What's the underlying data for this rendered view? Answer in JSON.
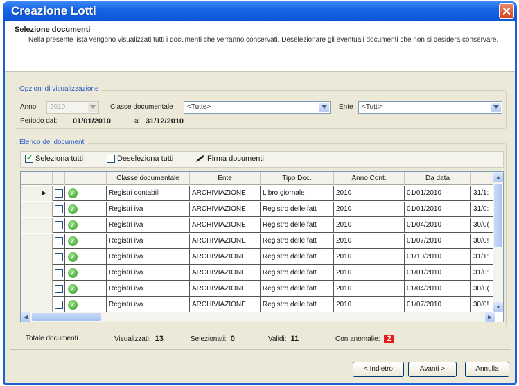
{
  "window": {
    "title": "Creazione Lotti"
  },
  "header": {
    "title": "Selezione documenti",
    "description": "Nella presente lista vengono visualizzati tutti i documenti che verranno conservati. Deselezionare gli eventuali documenti che non si desidera conservare."
  },
  "options": {
    "group_title": "Opzioni di visualizzazione",
    "anno_label": "Anno",
    "anno_value": "2010",
    "classe_label": "Classe documentale",
    "classe_value": "<Tutte>",
    "ente_label": "Ente",
    "ente_value": "<Tutti>",
    "periodo_label": "Periodo dal:",
    "periodo_from": "01/01/2010",
    "al_label": "al",
    "periodo_to": "31/12/2010"
  },
  "docs": {
    "group_title": "Elenco dei documenti",
    "toolbar": {
      "select_all": "Seleziona tutti",
      "deselect_all": "Deseleziona tutti",
      "sign": "Firma documenti"
    },
    "columns": [
      "Classe documentale",
      "Ente",
      "Tipo Doc.",
      "Anno Cont.",
      "Da data",
      ""
    ],
    "rows": [
      [
        "Registri contabili",
        "ARCHIVIAZIONE",
        "Libro giornale",
        "2010",
        "01/01/2010",
        "31/1:"
      ],
      [
        "Registri iva",
        "ARCHIVIAZIONE",
        "Registro delle fatt",
        "2010",
        "01/01/2010",
        "31/0:"
      ],
      [
        "Registri iva",
        "ARCHIVIAZIONE",
        "Registro delle fatt",
        "2010",
        "01/04/2010",
        "30/0("
      ],
      [
        "Registri iva",
        "ARCHIVIAZIONE",
        "Registro delle fatt",
        "2010",
        "01/07/2010",
        "30/0!"
      ],
      [
        "Registri iva",
        "ARCHIVIAZIONE",
        "Registro delle fatt",
        "2010",
        "01/10/2010",
        "31/1:"
      ],
      [
        "Registri iva",
        "ARCHIVIAZIONE",
        "Registro delle fatt",
        "2010",
        "01/01/2010",
        "31/0:"
      ],
      [
        "Registri iva",
        "ARCHIVIAZIONE",
        "Registro delle fatt",
        "2010",
        "01/04/2010",
        "30/0("
      ],
      [
        "Registri iva",
        "ARCHIVIAZIONE",
        "Registro delle fatt",
        "2010",
        "01/07/2010",
        "30/0!"
      ]
    ]
  },
  "status": {
    "totale_label": "Totale documenti",
    "visualizzati_label": "Visualizzati:",
    "visualizzati_value": "13",
    "selezionati_label": "Selezionati:",
    "selezionati_value": "0",
    "validi_label": "Validi:",
    "validi_value": "11",
    "anomalie_label": "Con anomalie:",
    "anomalie_value": "2"
  },
  "buttons": {
    "back": "< Indietro",
    "next": "Avanti >",
    "cancel": "Annulla"
  },
  "colors": {
    "titlebar": "#0b54d6",
    "anomaly": "#e41b1b",
    "group_title": "#2a5cc7"
  }
}
